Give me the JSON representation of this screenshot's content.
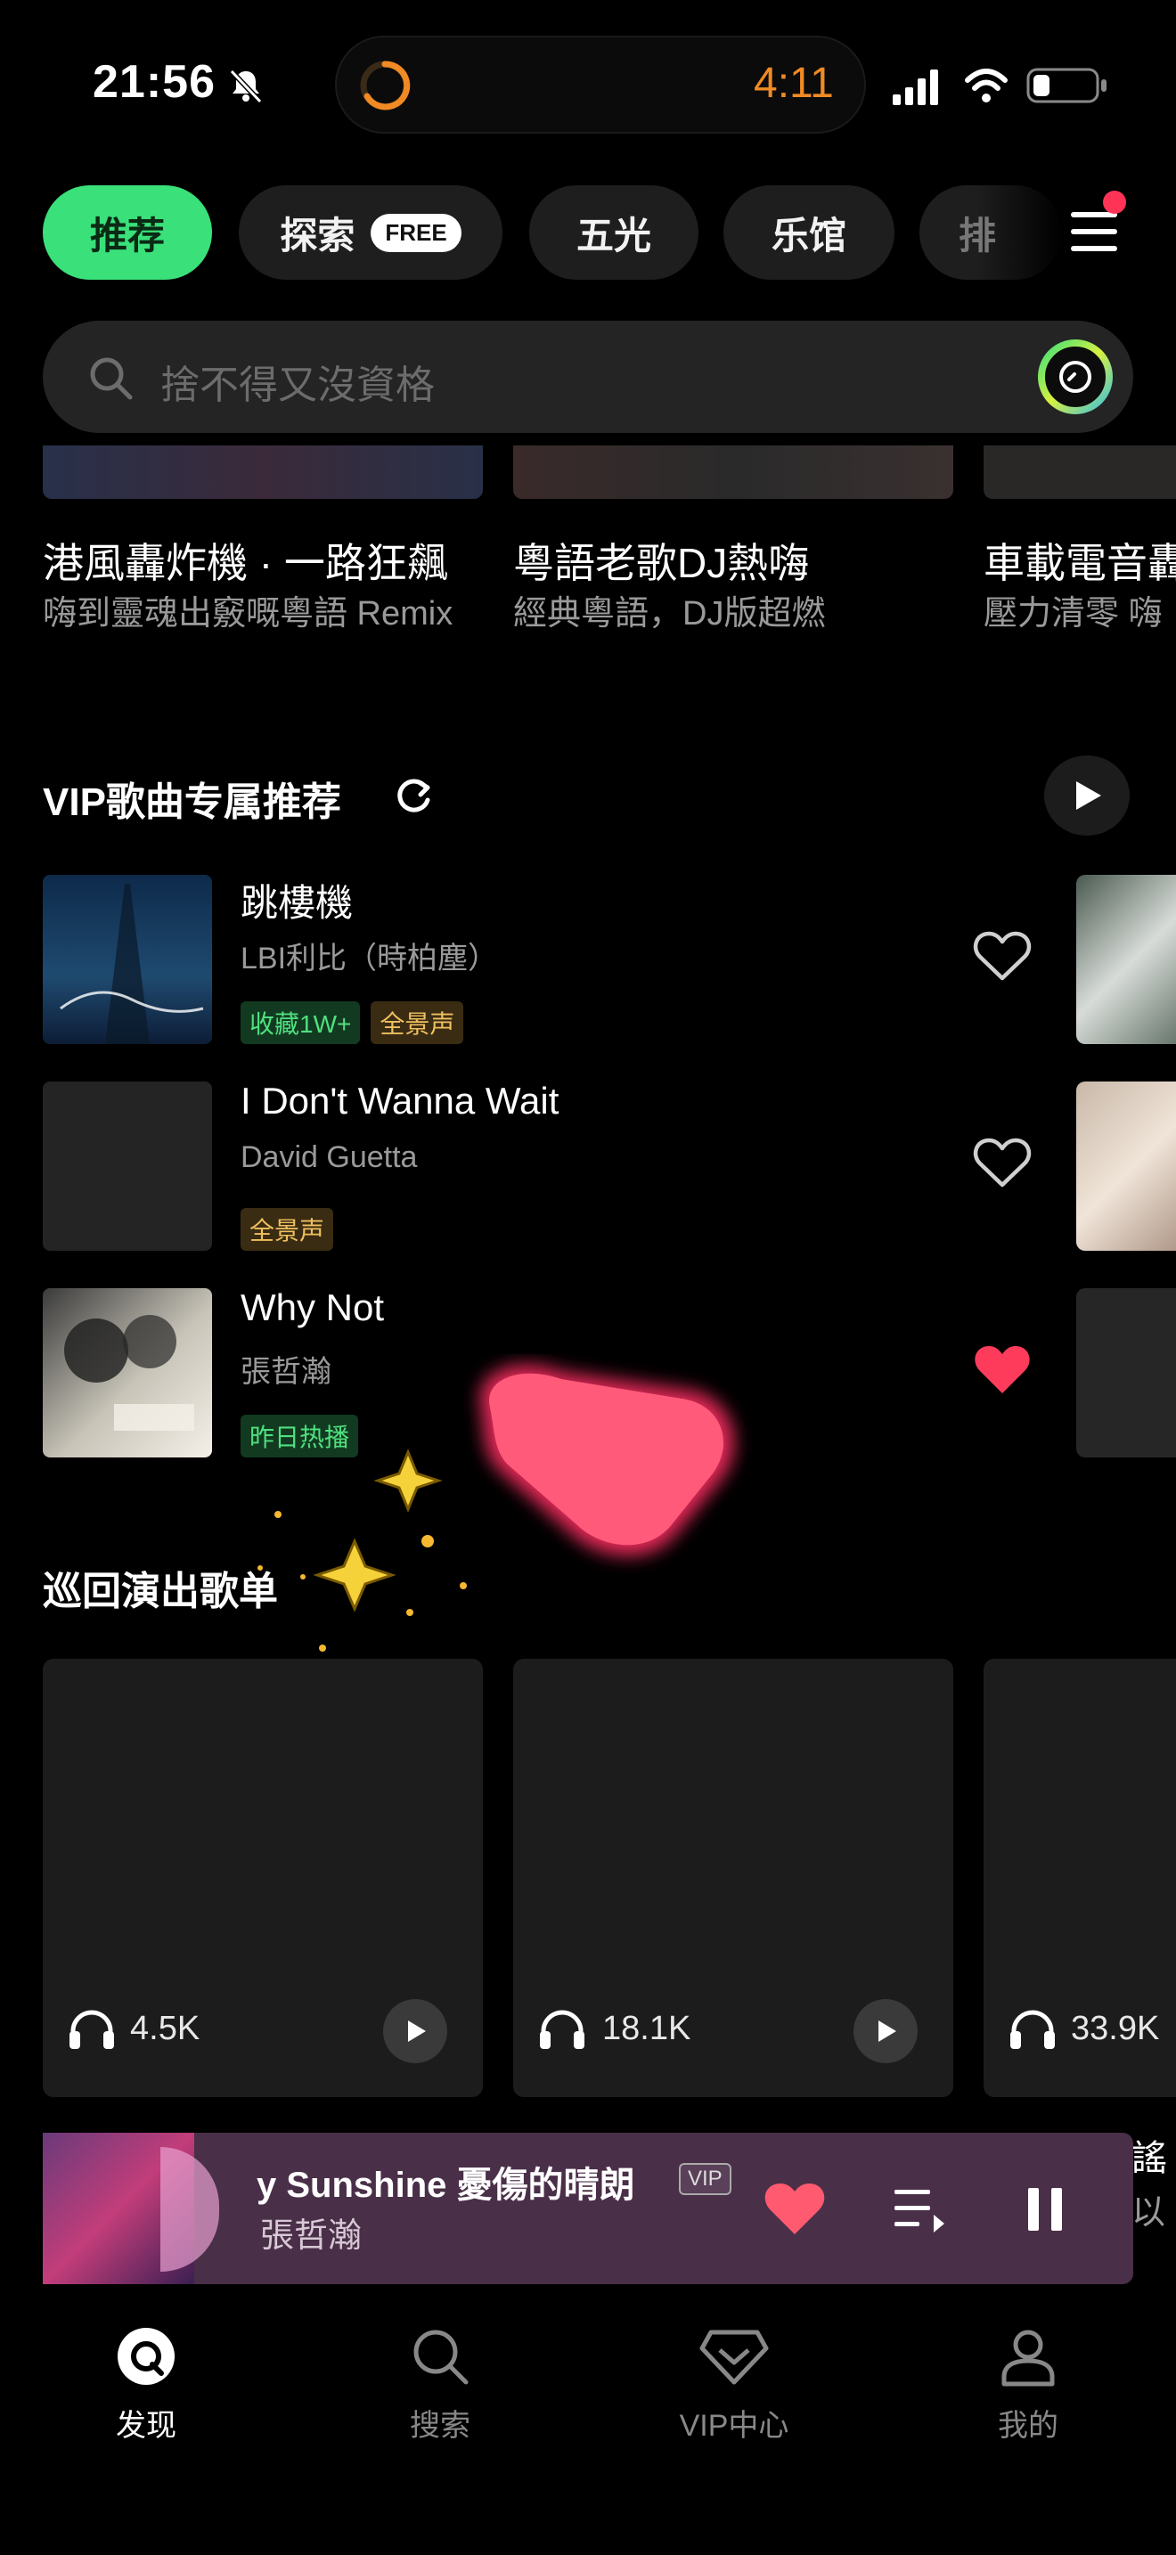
{
  "status_bar": {
    "time": "21:56",
    "island_timer": "4:11"
  },
  "tabs": [
    {
      "label": "推荐",
      "active": true
    },
    {
      "label": "探索",
      "badge": "FREE"
    },
    {
      "label": "五光"
    },
    {
      "label": "乐馆"
    },
    {
      "label": "排"
    }
  ],
  "search": {
    "placeholder": "捨不得又沒資格"
  },
  "playlists_top": [
    {
      "title": "港風轟炸機 · 一路狂飆",
      "subtitle": "嗨到靈魂出竅嘅粵語 Remix"
    },
    {
      "title": "粵語老歌DJ熱嗨",
      "subtitle": "經典粵語，DJ版超燃"
    },
    {
      "title": "車載電音轟",
      "subtitle": "壓力清零 嗨"
    }
  ],
  "vip_section": {
    "title": "VIP歌曲专属推荐",
    "songs": [
      {
        "title": "跳樓機",
        "artist": "LBI利比（時柏塵）",
        "tags": [
          "收藏1W+",
          "全景声"
        ],
        "liked": false
      },
      {
        "title": "I Don't Wanna Wait",
        "artist": "David Guetta",
        "tags": [
          "全景声"
        ],
        "liked": false
      },
      {
        "title": "Why Not",
        "artist": "張哲瀚",
        "tags": [
          "昨日热播"
        ],
        "liked": true
      }
    ]
  },
  "tour_section": {
    "title": "巡回演出歌单",
    "cards": [
      {
        "plays": "4.5K"
      },
      {
        "plays": "18.1K"
      },
      {
        "plays": "33.9K"
      }
    ]
  },
  "mini_player": {
    "title": "y Sunshine  憂傷的晴朗",
    "vip": "VIP",
    "artist": "張哲瀚",
    "side_text_1": "謠",
    "side_text_2": "以"
  },
  "bottom_nav": [
    {
      "label": "发现",
      "active": true
    },
    {
      "label": "搜索"
    },
    {
      "label": "VIP中心"
    },
    {
      "label": "我的"
    }
  ],
  "colors": {
    "accent_green": "#3ae07a",
    "heart_red": "#ff3b5c",
    "timer_orange": "#f08a24"
  }
}
